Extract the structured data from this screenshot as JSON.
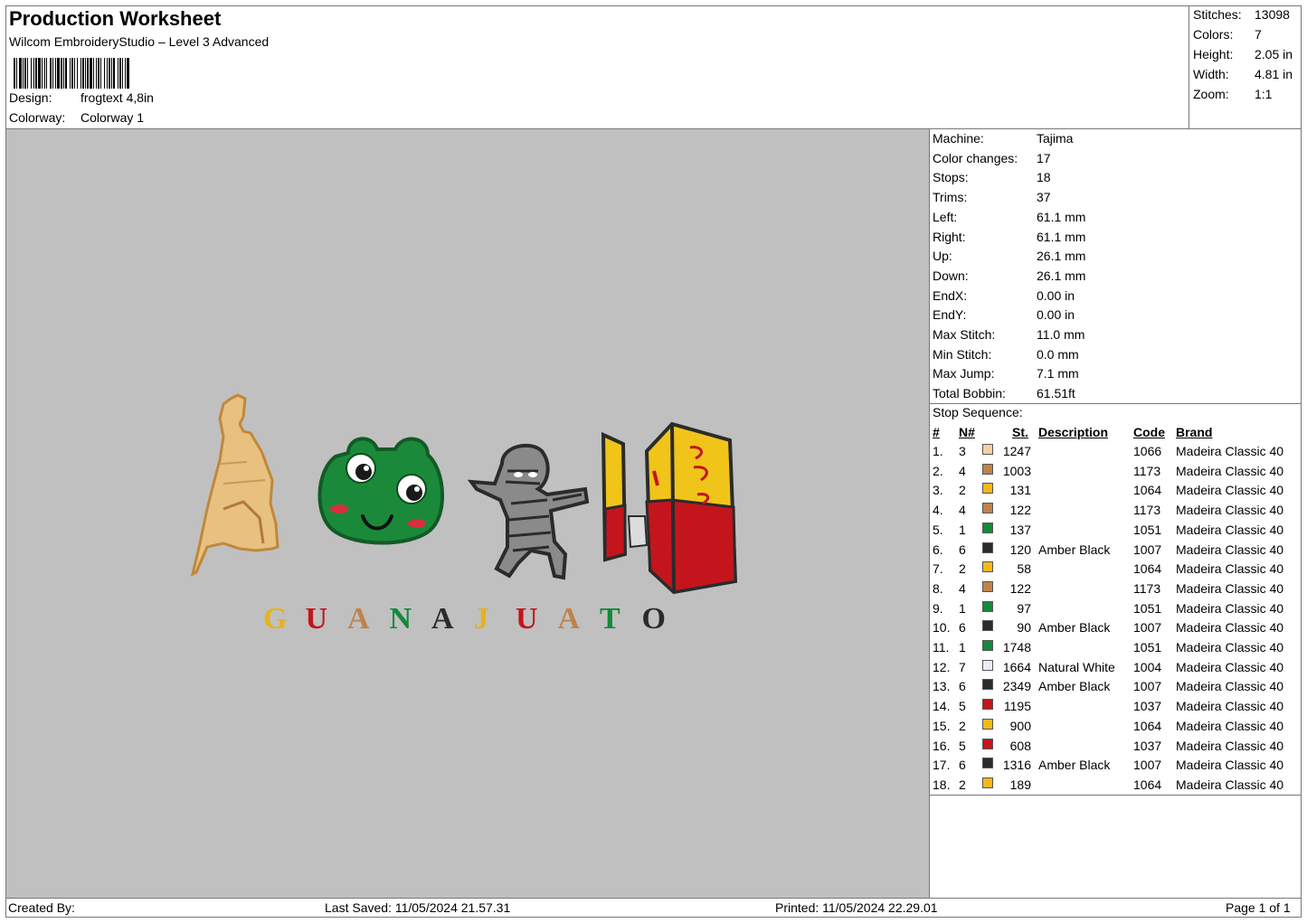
{
  "header": {
    "title": "Production Worksheet",
    "software": "Wilcom EmbroideryStudio – Level 3 Advanced",
    "design_label": "Design:",
    "design_value": "frogtext 4,8in",
    "colorway_label": "Colorway:",
    "colorway_value": "Colorway 1"
  },
  "stats": [
    {
      "label": "Stitches:",
      "value": "13098"
    },
    {
      "label": "Colors:",
      "value": "7"
    },
    {
      "label": "Height:",
      "value": "2.05 in"
    },
    {
      "label": "Width:",
      "value": "4.81 in"
    },
    {
      "label": "Zoom:",
      "value": "1:1"
    }
  ],
  "machine_info": [
    {
      "label": "Machine:",
      "value": "Tajima"
    },
    {
      "label": "Color changes:",
      "value": "17"
    },
    {
      "label": "Stops:",
      "value": "18"
    },
    {
      "label": "Trims:",
      "value": "37"
    },
    {
      "label": "Left:",
      "value": "61.1 mm"
    },
    {
      "label": "Right:",
      "value": "61.1 mm"
    },
    {
      "label": "Up:",
      "value": "26.1 mm"
    },
    {
      "label": "Down:",
      "value": "26.1 mm"
    },
    {
      "label": "EndX:",
      "value": "0.00 in"
    },
    {
      "label": "EndY:",
      "value": "0.00 in"
    },
    {
      "label": "Max Stitch:",
      "value": "11.0 mm"
    },
    {
      "label": "Min Stitch:",
      "value": "0.0 mm"
    },
    {
      "label": "Max Jump:",
      "value": "7.1 mm"
    },
    {
      "label": "Total Bobbin:",
      "value": "61.51ft"
    }
  ],
  "stop_sequence": {
    "title": "Stop Sequence:",
    "columns": {
      "num": "#",
      "n": "N#",
      "st": "St.",
      "desc": "Description",
      "code": "Code",
      "brand": "Brand"
    },
    "rows": [
      {
        "num": "1.",
        "n": "3",
        "color": "#f5cfa0",
        "st": "1247",
        "desc": "",
        "code": "1066",
        "brand": "Madeira Classic 40"
      },
      {
        "num": "2.",
        "n": "4",
        "color": "#c0824a",
        "st": "1003",
        "desc": "",
        "code": "1173",
        "brand": "Madeira Classic 40"
      },
      {
        "num": "3.",
        "n": "2",
        "color": "#f2b81a",
        "st": "131",
        "desc": "",
        "code": "1064",
        "brand": "Madeira Classic 40"
      },
      {
        "num": "4.",
        "n": "4",
        "color": "#c0824a",
        "st": "122",
        "desc": "",
        "code": "1173",
        "brand": "Madeira Classic 40"
      },
      {
        "num": "5.",
        "n": "1",
        "color": "#138a3a",
        "st": "137",
        "desc": "",
        "code": "1051",
        "brand": "Madeira Classic 40"
      },
      {
        "num": "6.",
        "n": "6",
        "color": "#2b2b2b",
        "st": "120",
        "desc": "Amber Black",
        "code": "1007",
        "brand": "Madeira Classic 40"
      },
      {
        "num": "7.",
        "n": "2",
        "color": "#f2b81a",
        "st": "58",
        "desc": "",
        "code": "1064",
        "brand": "Madeira Classic 40"
      },
      {
        "num": "8.",
        "n": "4",
        "color": "#c0824a",
        "st": "122",
        "desc": "",
        "code": "1173",
        "brand": "Madeira Classic 40"
      },
      {
        "num": "9.",
        "n": "1",
        "color": "#138a3a",
        "st": "97",
        "desc": "",
        "code": "1051",
        "brand": "Madeira Classic 40"
      },
      {
        "num": "10.",
        "n": "6",
        "color": "#2b2b2b",
        "st": "90",
        "desc": "Amber Black",
        "code": "1007",
        "brand": "Madeira Classic 40"
      },
      {
        "num": "11.",
        "n": "1",
        "color": "#138a3a",
        "st": "1748",
        "desc": "",
        "code": "1051",
        "brand": "Madeira Classic 40"
      },
      {
        "num": "12.",
        "n": "7",
        "color": "#ececf4",
        "st": "1664",
        "desc": "Natural White",
        "code": "1004",
        "brand": "Madeira Classic 40"
      },
      {
        "num": "13.",
        "n": "6",
        "color": "#2b2b2b",
        "st": "2349",
        "desc": "Amber Black",
        "code": "1007",
        "brand": "Madeira Classic 40"
      },
      {
        "num": "14.",
        "n": "5",
        "color": "#c4151c",
        "st": "1195",
        "desc": "",
        "code": "1037",
        "brand": "Madeira Classic 40"
      },
      {
        "num": "15.",
        "n": "2",
        "color": "#f2b81a",
        "st": "900",
        "desc": "",
        "code": "1064",
        "brand": "Madeira Classic 40"
      },
      {
        "num": "16.",
        "n": "5",
        "color": "#c4151c",
        "st": "608",
        "desc": "",
        "code": "1037",
        "brand": "Madeira Classic 40"
      },
      {
        "num": "17.",
        "n": "6",
        "color": "#2b2b2b",
        "st": "1316",
        "desc": "Amber Black",
        "code": "1007",
        "brand": "Madeira Classic 40"
      },
      {
        "num": "18.",
        "n": "2",
        "color": "#f2b81a",
        "st": "189",
        "desc": "",
        "code": "1064",
        "brand": "Madeira Classic 40"
      }
    ]
  },
  "design_preview": {
    "background": "#c0c0c0",
    "text": "GUANAJUATO",
    "letters": [
      {
        "ch": "G",
        "color": "#e8b21a"
      },
      {
        "ch": "U",
        "color": "#c4151c"
      },
      {
        "ch": "A",
        "color": "#c0824a"
      },
      {
        "ch": "N",
        "color": "#138a3a"
      },
      {
        "ch": "A",
        "color": "#2b2b2b"
      },
      {
        "ch": "J",
        "color": "#e8b21a"
      },
      {
        "ch": "U",
        "color": "#c4151c"
      },
      {
        "ch": "A",
        "color": "#c0824a"
      },
      {
        "ch": "T",
        "color": "#138a3a"
      },
      {
        "ch": "O",
        "color": "#2b2b2b"
      }
    ],
    "motifs": [
      "statue-motif",
      "frog-face-motif",
      "mummy-motif",
      "callejon-del-beso-motif"
    ]
  },
  "footer": {
    "created_by": "Created By:",
    "last_saved": "Last Saved: 11/05/2024 21.57.31",
    "printed": "Printed: 11/05/2024 22.29.01",
    "page": "Page 1 of 1"
  }
}
